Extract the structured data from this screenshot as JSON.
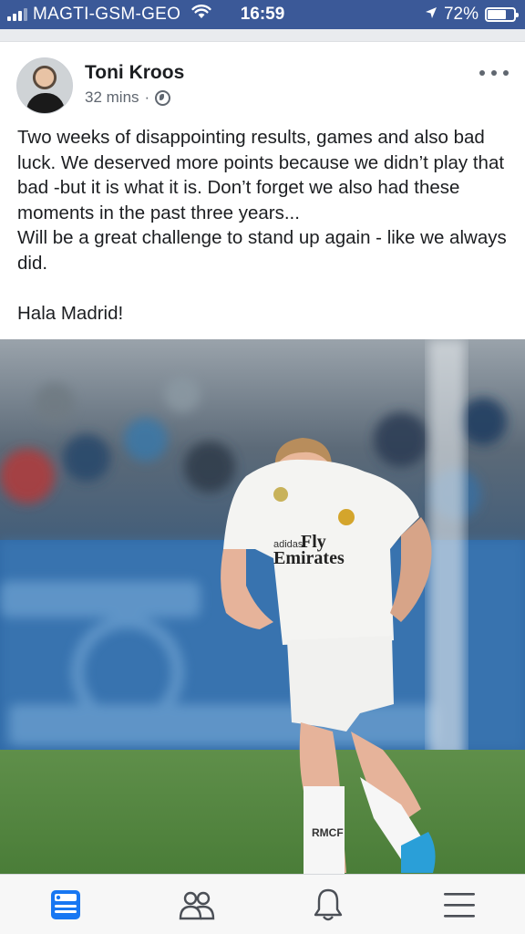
{
  "status_bar": {
    "carrier": "MAGTI-GSM-GEO",
    "time": "16:59",
    "battery_percent": "72%",
    "battery_level": 0.72
  },
  "post": {
    "author": "Toni Kroos",
    "time_ago": "32 mins",
    "separator": "·",
    "text": "Two weeks of disappointing results, games and also bad luck. We deserved more points because we didn’t play that bad -but it is what it is. Don’t forget we also had these moments in the past three years...\nWill be a great challenge to stand up again - like we always did.\n\nHala Madrid!",
    "photo_jersey_text": {
      "sponsor_line1": "Fly",
      "sponsor_line2": "Emirates"
    }
  },
  "tab_bar": {
    "icons": [
      "news-feed-icon",
      "friends-icon",
      "notifications-icon",
      "menu-icon"
    ],
    "active_index": 0
  },
  "colors": {
    "brand": "#3b5998",
    "active_tab": "#1877f2",
    "inactive_tab": "#4b4f56"
  }
}
